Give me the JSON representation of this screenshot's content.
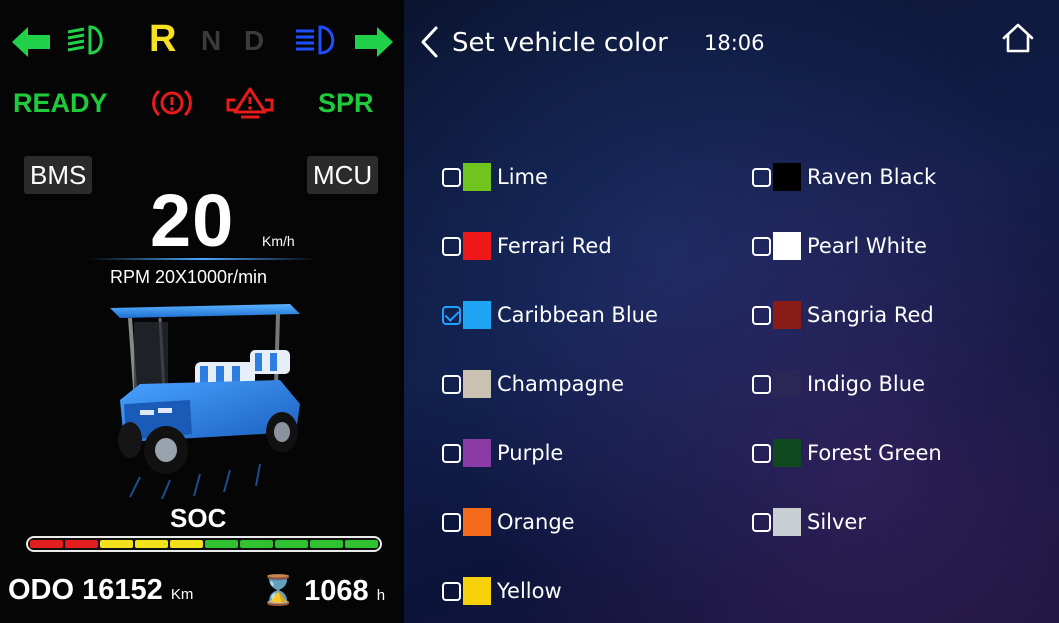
{
  "cluster": {
    "gears": {
      "r": "R",
      "n": "N",
      "d": "D"
    },
    "status": {
      "ready": "READY",
      "spr": "SPR"
    },
    "tags": {
      "bms": "BMS",
      "mcu": "MCU"
    },
    "speed": {
      "value": "20",
      "unit": "Km/h"
    },
    "rpm": "RPM 20X1000r/min",
    "soc": {
      "label": "SOC",
      "segments": [
        "#e41e1e",
        "#e41e1e",
        "#f2e21c",
        "#f2e21c",
        "#f2e21c",
        "#2fc12f",
        "#2fc12f",
        "#2fc12f",
        "#2fc12f",
        "#2fc12f"
      ]
    },
    "odo": {
      "label": "ODO",
      "value": "16152",
      "unit": "Km"
    },
    "hours": {
      "value": "1068",
      "unit": "h"
    },
    "colors": {
      "turn": "#22d14a",
      "warning": "#e61b1b",
      "high_beam": "#1f4fff"
    }
  },
  "panel": {
    "title": "Set vehicle color",
    "time": "18:06",
    "options": [
      {
        "label": "Lime",
        "color": "#6fc51d",
        "checked": false
      },
      {
        "label": "Raven Black",
        "color": "#000000",
        "checked": false
      },
      {
        "label": "Ferrari Red",
        "color": "#ee1818",
        "checked": false
      },
      {
        "label": "Pearl White",
        "color": "#ffffff",
        "checked": false
      },
      {
        "label": "Caribbean Blue",
        "color": "#1ea6f4",
        "checked": true
      },
      {
        "label": "Sangria Red",
        "color": "#8a1c17",
        "checked": false
      },
      {
        "label": "Champagne",
        "color": "#cbc1b3",
        "checked": false
      },
      {
        "label": "Indigo Blue",
        "color": "#2c2656",
        "checked": false
      },
      {
        "label": "Purple",
        "color": "#8b3aa6",
        "checked": false
      },
      {
        "label": "Forest Green",
        "color": "#0f4a1f",
        "checked": false
      },
      {
        "label": "Orange",
        "color": "#f46a1c",
        "checked": false
      },
      {
        "label": "Silver",
        "color": "#c9ced2",
        "checked": false
      },
      {
        "label": "Yellow",
        "color": "#f7d20c",
        "checked": false
      }
    ]
  }
}
